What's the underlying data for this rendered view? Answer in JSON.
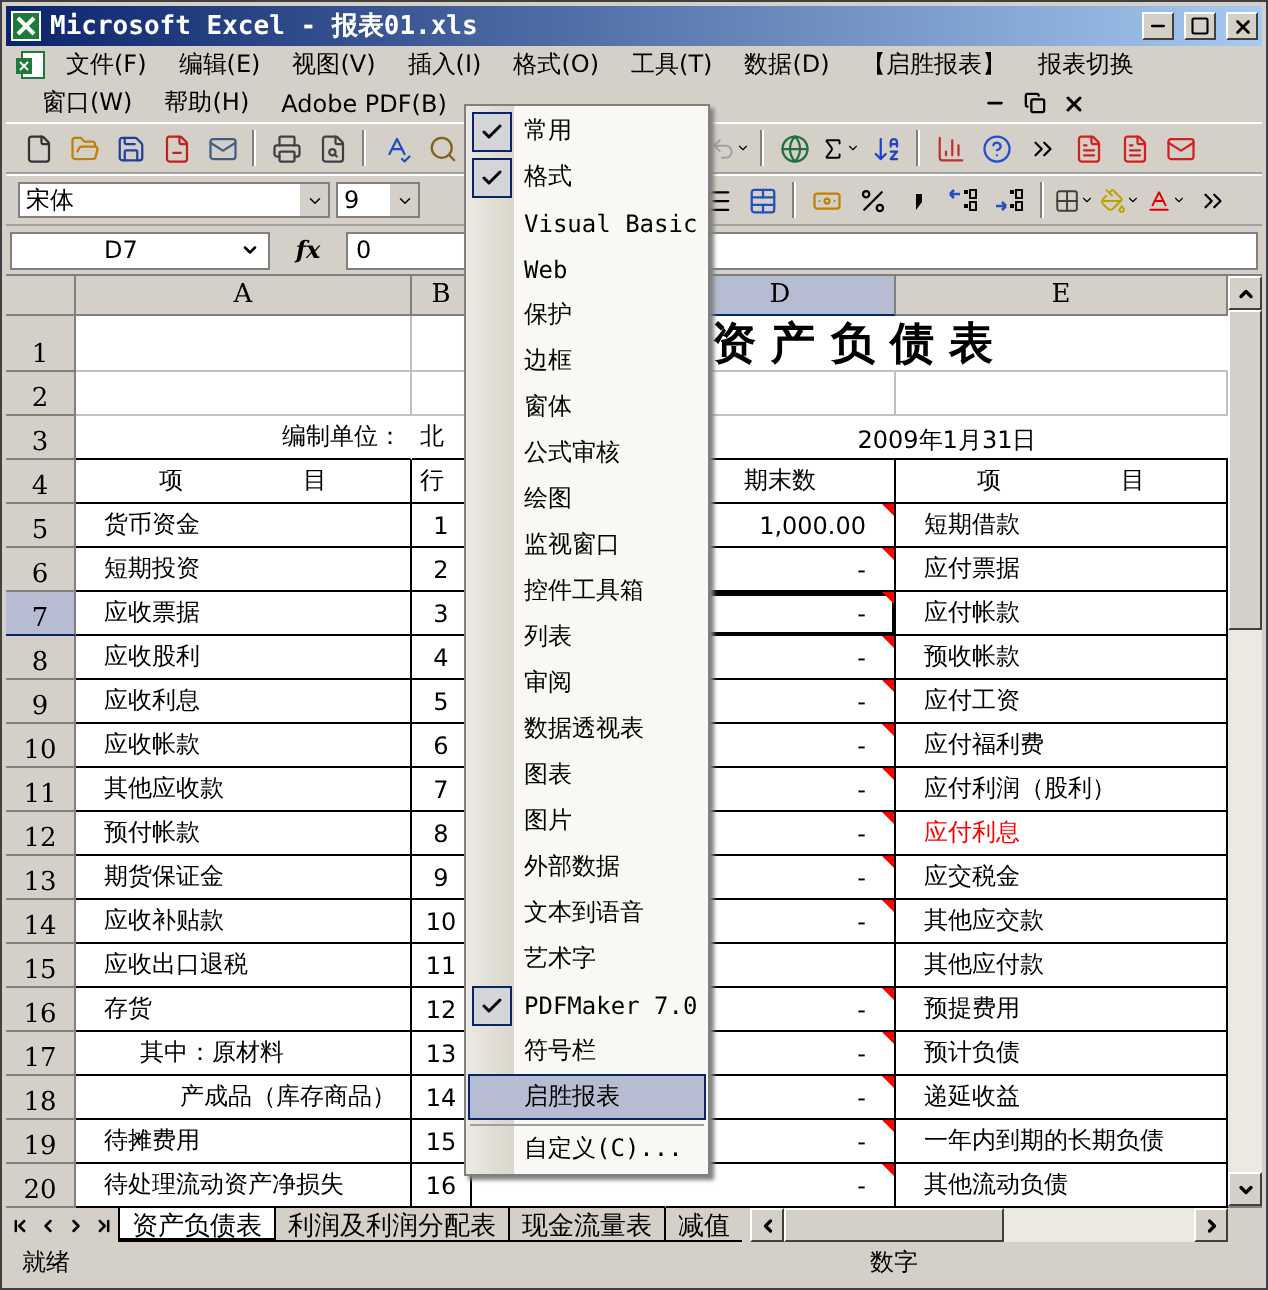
{
  "window": {
    "title": "Microsoft Excel - 报表01.xls"
  },
  "menu_rows": [
    [
      "文件(F)",
      "编辑(E)",
      "视图(V)",
      "插入(I)",
      "格式(O)",
      "工具(T)",
      "数据(D)",
      "【启胜报表】",
      "报表切换"
    ],
    [
      "窗口(W)",
      "帮助(H)",
      "Adobe PDF(B)"
    ]
  ],
  "formatting_toolbar": {
    "font": "宋体",
    "size": "9"
  },
  "formula_bar": {
    "name_box": "D7",
    "function_label": "fx",
    "value": "0"
  },
  "columns": [
    {
      "label": "A",
      "selected": false
    },
    {
      "label": "B",
      "selected": false
    },
    {
      "label": "D",
      "selected": true
    },
    {
      "label": "E",
      "selected": false
    }
  ],
  "sheet": {
    "title": "资 产 负 债 表",
    "unit_label": "编制单位：",
    "unit_value": "北",
    "date": "2009年1月31日",
    "top_row_numbers": [
      "1",
      "2",
      "3",
      "4"
    ],
    "headers": {
      "item": "项　　　　　目",
      "line": "行",
      "value": "期末数",
      "liability_item": "项　　　　　目"
    }
  },
  "rows": [
    {
      "number": "5",
      "item": "货币资金",
      "kind": "normal",
      "line": "1",
      "value": "1,000.00",
      "comment": true,
      "selected": false,
      "liability": "短期借款",
      "color": "#000000"
    },
    {
      "number": "6",
      "item": "短期投资",
      "kind": "normal",
      "line": "2",
      "value": "-",
      "comment": true,
      "selected": false,
      "liability": "应付票据",
      "color": "#000000"
    },
    {
      "number": "7",
      "item": "应收票据",
      "kind": "normal",
      "line": "3",
      "value": "-",
      "comment": true,
      "selected": true,
      "liability": "应付帐款",
      "color": "#000000"
    },
    {
      "number": "8",
      "item": "应收股利",
      "kind": "normal",
      "line": "4",
      "value": "-",
      "comment": true,
      "selected": false,
      "liability": "预收帐款",
      "color": "#000000"
    },
    {
      "number": "9",
      "item": "应收利息",
      "kind": "normal",
      "line": "5",
      "value": "-",
      "comment": true,
      "selected": false,
      "liability": "应付工资",
      "color": "#000000"
    },
    {
      "number": "10",
      "item": "应收帐款",
      "kind": "normal",
      "line": "6",
      "value": "-",
      "comment": true,
      "selected": false,
      "liability": "应付福利费",
      "color": "#000000"
    },
    {
      "number": "11",
      "item": "其他应收款",
      "kind": "normal",
      "line": "7",
      "value": "-",
      "comment": true,
      "selected": false,
      "liability": "应付利润（股利）",
      "color": "#000000"
    },
    {
      "number": "12",
      "item": "预付帐款",
      "kind": "normal",
      "line": "8",
      "value": "-",
      "comment": true,
      "selected": false,
      "liability": "应付利息",
      "color": "#ff0000"
    },
    {
      "number": "13",
      "item": "期货保证金",
      "kind": "normal",
      "line": "9",
      "value": "-",
      "comment": true,
      "selected": false,
      "liability": "应交税金",
      "color": "#000000"
    },
    {
      "number": "14",
      "item": "应收补贴款",
      "kind": "normal",
      "line": "10",
      "value": "-",
      "comment": true,
      "selected": false,
      "liability": "其他应交款",
      "color": "#000000"
    },
    {
      "number": "15",
      "item": "应收出口退税",
      "kind": "normal",
      "line": "11",
      "comment": false,
      "selected": false,
      "liability": "其他应付款",
      "color": "#000000"
    },
    {
      "number": "16",
      "item": "存货",
      "kind": "normal",
      "line": "12",
      "value": "-",
      "comment": true,
      "selected": false,
      "liability": "预提费用",
      "color": "#000000"
    },
    {
      "number": "17",
      "item": "其中：原材料",
      "kind": "sub",
      "line": "13",
      "value": "-",
      "comment": true,
      "selected": false,
      "liability": "预计负债",
      "color": "#000000"
    },
    {
      "number": "18",
      "item": "产成品（库存商品）",
      "kind": "detail",
      "line": "14",
      "value": "-",
      "comment": true,
      "selected": false,
      "liability": "递延收益",
      "color": "#000000"
    },
    {
      "number": "19",
      "item": "待摊费用",
      "kind": "normal",
      "line": "15",
      "value": "-",
      "comment": true,
      "selected": false,
      "liability": "一年内到期的长期负债",
      "color": "#000000"
    },
    {
      "number": "20",
      "item": "待处理流动资产净损失",
      "kind": "normal",
      "line": "16",
      "value": "-",
      "comment": true,
      "selected": false,
      "liability": "其他流动负债",
      "color": "#000000"
    }
  ],
  "toolbar_menu": [
    {
      "label": "常用",
      "checked": true,
      "selected": false
    },
    {
      "label": "格式",
      "checked": true,
      "selected": false
    },
    {
      "label": "Visual Basic",
      "checked": false,
      "selected": false
    },
    {
      "label": "Web",
      "checked": false,
      "selected": false
    },
    {
      "label": "保护",
      "checked": false,
      "selected": false
    },
    {
      "label": "边框",
      "checked": false,
      "selected": false
    },
    {
      "label": "窗体",
      "checked": false,
      "selected": false
    },
    {
      "label": "公式审核",
      "checked": false,
      "selected": false
    },
    {
      "label": "绘图",
      "checked": false,
      "selected": false
    },
    {
      "label": "监视窗口",
      "checked": false,
      "selected": false
    },
    {
      "label": "控件工具箱",
      "checked": false,
      "selected": false
    },
    {
      "label": "列表",
      "checked": false,
      "selected": false
    },
    {
      "label": "审阅",
      "checked": false,
      "selected": false
    },
    {
      "label": "数据透视表",
      "checked": false,
      "selected": false
    },
    {
      "label": "图表",
      "checked": false,
      "selected": false
    },
    {
      "label": "图片",
      "checked": false,
      "selected": false
    },
    {
      "label": "外部数据",
      "checked": false,
      "selected": false
    },
    {
      "label": "文本到语音",
      "checked": false,
      "selected": false
    },
    {
      "label": "艺术字",
      "checked": false,
      "selected": false
    },
    {
      "label": "PDFMaker 7.0",
      "checked": true,
      "selected": false
    },
    {
      "label": "符号栏",
      "checked": false,
      "selected": false
    },
    {
      "label": "启胜报表",
      "checked": false,
      "selected": true
    },
    {
      "label": "自定义(C)...",
      "checked": false,
      "selected": false,
      "separator_before": true
    }
  ],
  "sheet_tabs": [
    {
      "label": "资产负债表",
      "selected": true
    },
    {
      "label": "利润及利润分配表",
      "selected": false
    },
    {
      "label": "现金流量表",
      "selected": false
    },
    {
      "label": "减值",
      "selected": false
    }
  ],
  "status_bar": {
    "message": "就绪",
    "mode": "数字"
  }
}
